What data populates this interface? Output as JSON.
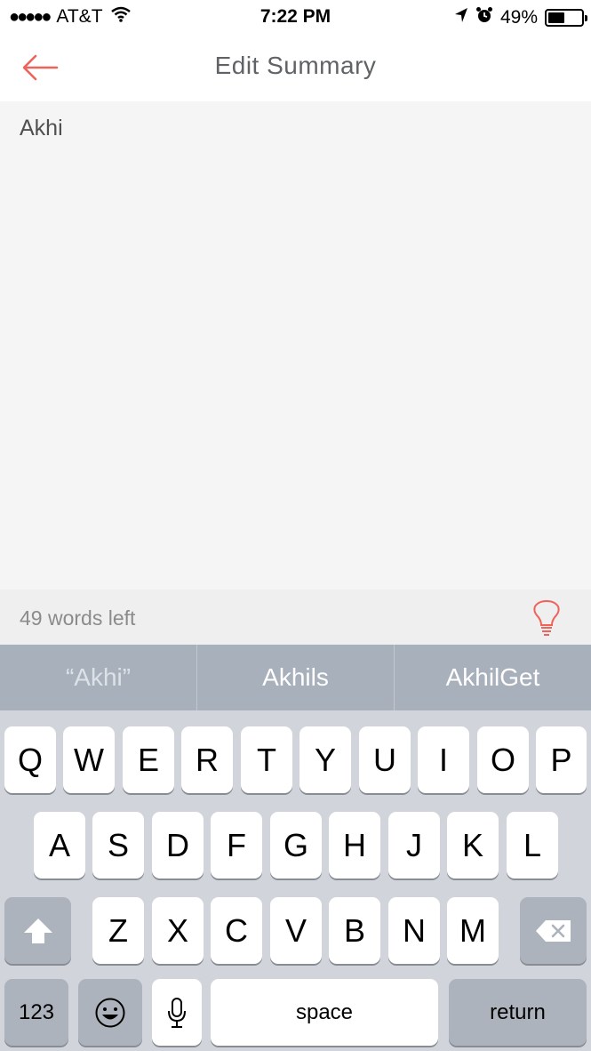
{
  "status_bar": {
    "signal": "●●●●●",
    "carrier": "AT&T",
    "time": "7:22 PM",
    "battery": "49%",
    "battery_level": 0.49
  },
  "nav": {
    "title": "Edit Summary",
    "accent_color": "#f0635b"
  },
  "editor": {
    "text": "Akhi"
  },
  "info_bar": {
    "words_left": "49 words left"
  },
  "predictions": [
    "“Akhi”",
    "Akhils",
    "AkhilGet"
  ],
  "keyboard": {
    "row1": [
      "Q",
      "W",
      "E",
      "R",
      "T",
      "Y",
      "U",
      "I",
      "O",
      "P"
    ],
    "row2": [
      "A",
      "S",
      "D",
      "F",
      "G",
      "H",
      "J",
      "K",
      "L"
    ],
    "row3": [
      "Z",
      "X",
      "C",
      "V",
      "B",
      "N",
      "M"
    ],
    "numbers_label": "123",
    "space_label": "space",
    "return_label": "return"
  }
}
